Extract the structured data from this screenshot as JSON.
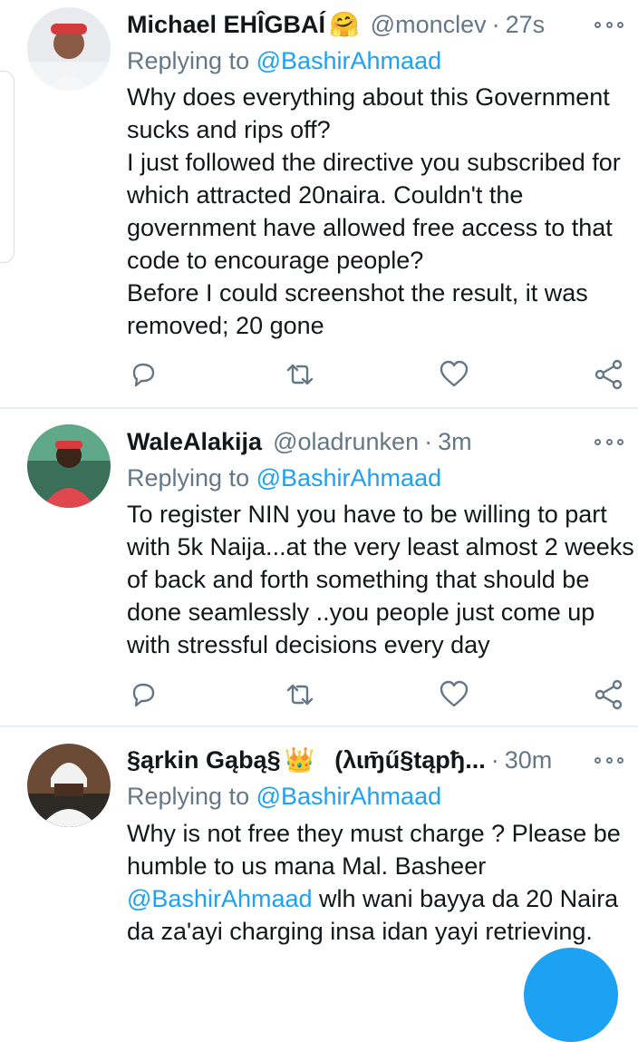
{
  "tweets": [
    {
      "name": "Michael EHÎGBAÍ",
      "emoji": "🤗",
      "handle": "@monclev",
      "time": "27s",
      "replying_prefix": "Replying to ",
      "replying_to": "@BashirAhmaad",
      "body": "Why does everything about this Government sucks and rips off?\nI just followed the directive you subscribed for which attracted 20naira. Couldn't the government have allowed free access to that code to encourage people?\nBefore I could screenshot the result, it was removed; 20 gone"
    },
    {
      "name": "WaleAlakija",
      "handle": "@oladrunken",
      "time": "3m",
      "replying_prefix": "Replying to ",
      "replying_to": "@BashirAhmaad",
      "body": "To register NIN you have to be willing to part with 5k Naija...at the very least almost 2 weeks of back and forth something that should be done seamlessly ..you people just come up with stressful decisions every day"
    },
    {
      "name": "§ąrkin Gąbą§",
      "emoji": "👑",
      "handle": "(λɩɱ̄ű§tąpђ...",
      "time": "30m",
      "replying_prefix": "Replying to ",
      "replying_to": "@BashirAhmaad",
      "body_before": "Why is not free they must charge ? Please be humble to us mana Mal. Basheer\n",
      "body_mention": "@BashirAhmaad",
      "body_after": " wlh wani bayya da 20 Naira da za'ayi charging insa idan yayi retrieving."
    }
  ],
  "icons": {
    "reply": "reply-icon",
    "retweet": "retweet-icon",
    "like": "heart-icon",
    "share": "share-icon",
    "more": "more-icon"
  },
  "colors": {
    "link": "#1da1f2",
    "muted": "#657786",
    "divider": "#e6ecf0"
  }
}
